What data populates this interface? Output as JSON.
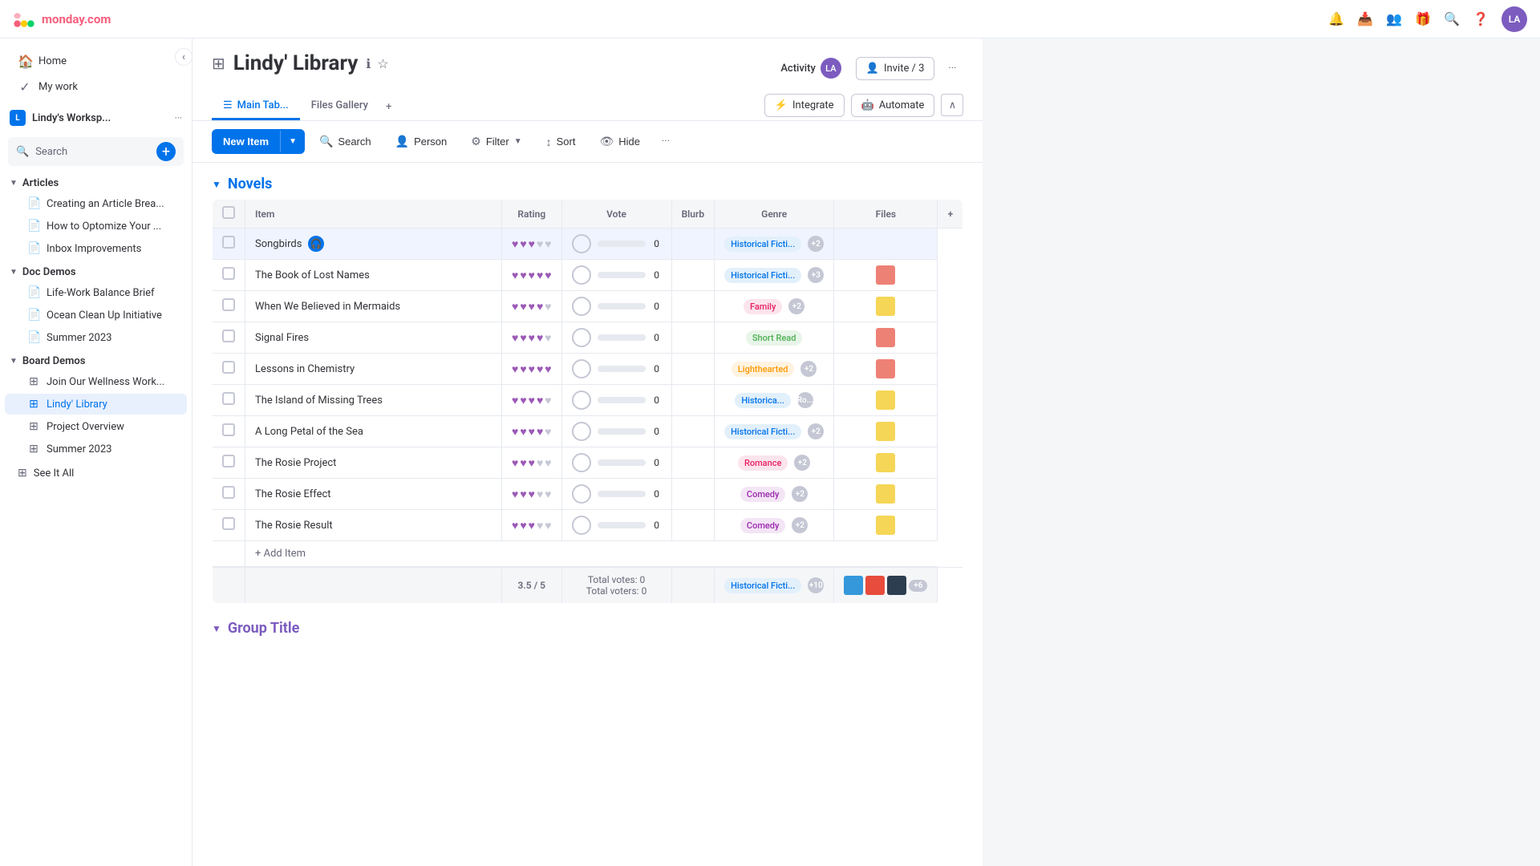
{
  "app": {
    "name": "monday.com"
  },
  "topbar": {
    "workspace_label": "Lindy's Worksp...",
    "avatar_initials": "LA"
  },
  "sidebar": {
    "workspace": {
      "badge": "L",
      "name": "Lindy's Worksp..."
    },
    "nav": [
      {
        "id": "home",
        "label": "Home",
        "icon": "🏠"
      },
      {
        "id": "my-work",
        "label": "My work",
        "icon": "✓"
      }
    ],
    "search_placeholder": "Search",
    "sections": [
      {
        "id": "articles",
        "label": "Articles",
        "items": [
          {
            "id": "creating",
            "label": "Creating an Article Brea...",
            "icon": "📄"
          },
          {
            "id": "how-to",
            "label": "How to Optomize Your ...",
            "icon": "📄"
          },
          {
            "id": "inbox",
            "label": "Inbox Improvements",
            "icon": "📄"
          }
        ]
      },
      {
        "id": "doc-demos",
        "label": "Doc Demos",
        "items": [
          {
            "id": "life-work",
            "label": "Life-Work Balance Brief",
            "icon": "📄"
          },
          {
            "id": "ocean",
            "label": "Ocean Clean Up Initiative",
            "icon": "📄"
          },
          {
            "id": "summer-2023-doc",
            "label": "Summer 2023",
            "icon": "📄"
          }
        ]
      },
      {
        "id": "board-demos",
        "label": "Board Demos",
        "items": [
          {
            "id": "join-wellness",
            "label": "Join Our Wellness Work...",
            "icon": "⊞"
          },
          {
            "id": "lindy-library",
            "label": "Lindy' Library",
            "icon": "⊞",
            "active": true
          },
          {
            "id": "project-overview",
            "label": "Project Overview",
            "icon": "⊞"
          },
          {
            "id": "summer-2023",
            "label": "Summer 2023",
            "icon": "⊞"
          }
        ]
      }
    ],
    "footer": {
      "label": "See It All",
      "icon": "⊞"
    }
  },
  "board": {
    "title": "Lindy' Library",
    "tabs": [
      {
        "id": "main-table",
        "label": "Main Tab...",
        "active": true
      },
      {
        "id": "files-gallery",
        "label": "Files Gallery",
        "active": false
      }
    ],
    "activity_label": "Activity",
    "invite_label": "Invite / 3",
    "integrate_label": "Integrate",
    "automate_label": "Automate"
  },
  "toolbar": {
    "new_item_label": "New Item",
    "search_label": "Search",
    "person_label": "Person",
    "filter_label": "Filter",
    "sort_label": "Sort",
    "hide_label": "Hide"
  },
  "novels_group": {
    "title": "Novels",
    "columns": [
      "Item",
      "Rating",
      "Vote",
      "Blurb",
      "Genre",
      "Files"
    ],
    "rows": [
      {
        "name": "Songbirds",
        "rating": 3,
        "vote": 0,
        "genre": "Historical Ficti...",
        "genre_type": "historical",
        "genre_count": "+2",
        "has_files": false,
        "has_action": true
      },
      {
        "name": "The Book of Lost Names",
        "rating": 5,
        "vote": 0,
        "genre": "Historical Ficti...",
        "genre_type": "historical",
        "genre_count": "+3",
        "has_files": true
      },
      {
        "name": "When We Believed in Mermaids",
        "rating": 4,
        "vote": 0,
        "genre": "Family",
        "genre_type": "family",
        "genre_count": "+2",
        "has_files": true
      },
      {
        "name": "Signal Fires",
        "rating": 4,
        "vote": 0,
        "genre": "Short Read",
        "genre_type": "short-read",
        "genre_count": "",
        "has_files": true
      },
      {
        "name": "Lessons in Chemistry",
        "rating": 5,
        "vote": 0,
        "genre": "Lighthearted",
        "genre_type": "lighthearted",
        "genre_count": "+2",
        "has_files": true
      },
      {
        "name": "The Island of Missing Trees",
        "rating": 4,
        "vote": 0,
        "genre": "Historica...",
        "genre_type": "historical",
        "genre_count": "Ro...",
        "has_files": true
      },
      {
        "name": "A Long Petal of the Sea",
        "rating": 4,
        "vote": 0,
        "genre": "Historical Ficti...",
        "genre_type": "historical",
        "genre_count": "+2",
        "has_files": true
      },
      {
        "name": "The Rosie Project",
        "rating": 3,
        "vote": 0,
        "genre": "Romance",
        "genre_type": "romance",
        "genre_count": "+2",
        "has_files": true
      },
      {
        "name": "The Rosie Effect",
        "rating": 3,
        "vote": 0,
        "genre": "Comedy",
        "genre_type": "comedy",
        "genre_count": "+2",
        "has_files": true
      },
      {
        "name": "The Rosie Result",
        "rating": 3,
        "vote": 0,
        "genre": "Comedy",
        "genre_type": "comedy",
        "genre_count": "+2",
        "has_files": true
      }
    ],
    "add_item_label": "+ Add Item",
    "footer": {
      "rating": "3.5 / 5",
      "votes_total": "Total votes: 0",
      "voters_total": "Total voters: 0",
      "genre_primary": "Historical Ficti...",
      "genre_extra": "+10"
    }
  },
  "group_title": {
    "title": "Group Title"
  }
}
